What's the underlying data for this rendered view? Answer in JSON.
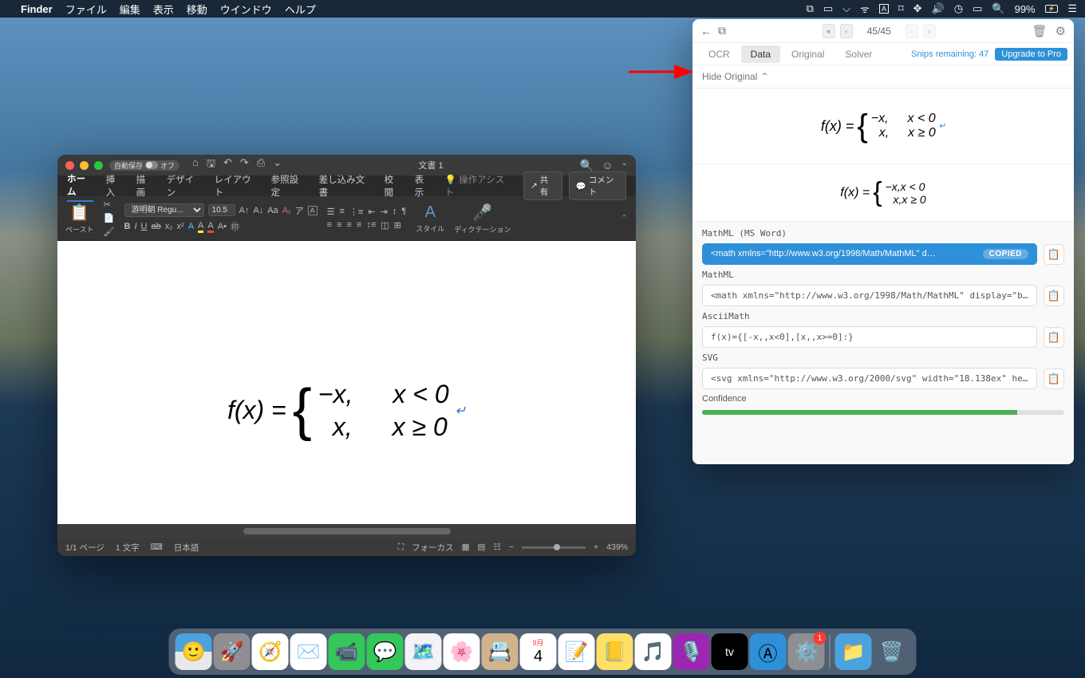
{
  "menubar": {
    "app": "Finder",
    "items": [
      "ファイル",
      "編集",
      "表示",
      "移動",
      "ウインドウ",
      "ヘルプ"
    ],
    "battery": "99%"
  },
  "word": {
    "autosave_label": "自動保存",
    "autosave_state": "オフ",
    "doc_title": "文書 1",
    "tabs": [
      "ホーム",
      "挿入",
      "描画",
      "デザイン",
      "レイアウト",
      "参照設定",
      "差し込み文書",
      "校閲",
      "表示"
    ],
    "assist": "操作アシスト",
    "share": "共有",
    "comment": "コメント",
    "font_name": "游明朝 Regu...",
    "font_size": "10.5",
    "paste_label": "ペースト",
    "style_label": "スタイル",
    "dictation_label": "ディクテーション",
    "equation": {
      "fx": "f(x) =",
      "c1a": "−x,",
      "c1b": "x < 0",
      "c2a": "x,",
      "c2b": "x ≥ 0"
    },
    "status": {
      "page": "1/1 ページ",
      "words": "1 文字",
      "lang": "日本語",
      "focus": "フォーカス",
      "zoom": "439%"
    }
  },
  "mathpix": {
    "counter": "45/45",
    "tabs": [
      "OCR",
      "Data",
      "Original",
      "Solver"
    ],
    "active_tab": "Data",
    "remaining": "Snips remaining: 47",
    "upgrade": "Upgrade to Pro",
    "hide": "Hide Original",
    "outputs": {
      "mathml_word_label": "MathML (MS Word)",
      "mathml_word_code": "<math xmlns=\"http://www.w3.org/1998/Math/MathML\" d…",
      "copied": "COPIED",
      "mathml_label": "MathML",
      "mathml_code": "<math xmlns=\"http://www.w3.org/1998/Math/MathML\" display=\"bl…",
      "ascii_label": "AsciiMath",
      "ascii_code": "f(x)={[-x,,x<0],[x,,x>=0]:}",
      "svg_label": "SVG",
      "svg_code": "<svg xmlns=\"http://www.w3.org/2000/svg\" width=\"18.138ex\" hei…",
      "confidence": "Confidence"
    },
    "eq": {
      "fx": "f(x) =",
      "c1a": "−x,",
      "c1b": "x < 0",
      "c2a": "x,",
      "c2b": "x ≥ 0",
      "r1": "−x,x < 0",
      "r2": "x,x ≥ 0"
    }
  },
  "dock": {
    "calendar_day": "4",
    "calendar_month": "9月",
    "badge": "1"
  }
}
